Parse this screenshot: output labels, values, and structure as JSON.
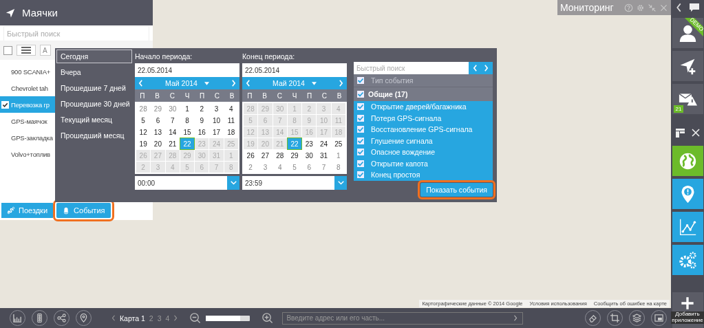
{
  "header": {
    "title": "Мониторинг"
  },
  "map": {
    "attribution": [
      "Картографические данные © 2014 Google",
      "Условия использования",
      "Сообщить об ошибке на карте"
    ]
  },
  "beacons_panel": {
    "title": "Маячки",
    "search": {
      "placeholder": "Быстрый поиск"
    },
    "select_all": {
      "checked": false
    },
    "sort_button": "A",
    "items": [
      {
        "label": "900 SCANIA+",
        "checked": false
      },
      {
        "label": "Chevrolet tah",
        "checked": false
      },
      {
        "label": "Перевозка гр",
        "checked": true
      },
      {
        "label": "GPS-маячок",
        "checked": false
      },
      {
        "label": "GPS-закладка",
        "checked": false
      },
      {
        "label": "Volvo+топлив",
        "checked": false
      }
    ],
    "buttons": [
      {
        "label": "Поездки",
        "kind": "trips",
        "highlighted": false
      },
      {
        "label": "События",
        "kind": "events",
        "highlighted": true
      }
    ]
  },
  "period_popup": {
    "presets": [
      {
        "label": "Сегодня",
        "selected": true
      },
      {
        "label": "Вчера",
        "selected": false
      },
      {
        "label": "Прошедшие 7 дней",
        "selected": false
      },
      {
        "label": "Прошедшие 30 дней",
        "selected": false
      },
      {
        "label": "Текущий месяц",
        "selected": false
      },
      {
        "label": "Прошедший месяц",
        "selected": false
      }
    ],
    "calendars": [
      {
        "label": "Начало периода:",
        "date": "22.05.2014",
        "month": "Май 2014",
        "time": "00:00",
        "weekdays": [
          "П",
          "В",
          "С",
          "Ч",
          "П",
          "С",
          "В"
        ],
        "days": [
          {
            "label": "28",
            "other_month": true,
            "disabled": false,
            "selected": false
          },
          {
            "label": "29",
            "other_month": true,
            "disabled": false,
            "selected": false
          },
          {
            "label": "30",
            "other_month": true,
            "disabled": false,
            "selected": false
          },
          {
            "label": "1",
            "other_month": false,
            "disabled": false,
            "selected": false
          },
          {
            "label": "2",
            "other_month": false,
            "disabled": false,
            "selected": false
          },
          {
            "label": "3",
            "other_month": false,
            "disabled": false,
            "selected": false
          },
          {
            "label": "4",
            "other_month": false,
            "disabled": false,
            "selected": false
          },
          {
            "label": "5",
            "other_month": false,
            "disabled": false,
            "selected": false
          },
          {
            "label": "6",
            "other_month": false,
            "disabled": false,
            "selected": false
          },
          {
            "label": "7",
            "other_month": false,
            "disabled": false,
            "selected": false
          },
          {
            "label": "8",
            "other_month": false,
            "disabled": false,
            "selected": false
          },
          {
            "label": "9",
            "other_month": false,
            "disabled": false,
            "selected": false
          },
          {
            "label": "10",
            "other_month": false,
            "disabled": false,
            "selected": false
          },
          {
            "label": "11",
            "other_month": false,
            "disabled": false,
            "selected": false
          },
          {
            "label": "12",
            "other_month": false,
            "disabled": false,
            "selected": false
          },
          {
            "label": "13",
            "other_month": false,
            "disabled": false,
            "selected": false
          },
          {
            "label": "14",
            "other_month": false,
            "disabled": false,
            "selected": false
          },
          {
            "label": "15",
            "other_month": false,
            "disabled": false,
            "selected": false
          },
          {
            "label": "16",
            "other_month": false,
            "disabled": false,
            "selected": false
          },
          {
            "label": "17",
            "other_month": false,
            "disabled": false,
            "selected": false
          },
          {
            "label": "18",
            "other_month": false,
            "disabled": false,
            "selected": false
          },
          {
            "label": "19",
            "other_month": false,
            "disabled": false,
            "selected": false
          },
          {
            "label": "20",
            "other_month": false,
            "disabled": false,
            "selected": false
          },
          {
            "label": "21",
            "other_month": false,
            "disabled": false,
            "selected": false
          },
          {
            "label": "22",
            "other_month": false,
            "disabled": false,
            "selected": true
          },
          {
            "label": "23",
            "other_month": false,
            "disabled": true,
            "selected": false
          },
          {
            "label": "24",
            "other_month": false,
            "disabled": true,
            "selected": false
          },
          {
            "label": "25",
            "other_month": false,
            "disabled": true,
            "selected": false
          },
          {
            "label": "26",
            "other_month": false,
            "disabled": true,
            "selected": false
          },
          {
            "label": "27",
            "other_month": false,
            "disabled": true,
            "selected": false
          },
          {
            "label": "28",
            "other_month": false,
            "disabled": true,
            "selected": false
          },
          {
            "label": "29",
            "other_month": false,
            "disabled": true,
            "selected": false
          },
          {
            "label": "30",
            "other_month": false,
            "disabled": true,
            "selected": false
          },
          {
            "label": "31",
            "other_month": false,
            "disabled": true,
            "selected": false
          },
          {
            "label": "1",
            "other_month": true,
            "disabled": true,
            "selected": false
          },
          {
            "label": "2",
            "other_month": true,
            "disabled": true,
            "selected": false
          },
          {
            "label": "3",
            "other_month": true,
            "disabled": true,
            "selected": false
          },
          {
            "label": "4",
            "other_month": true,
            "disabled": true,
            "selected": false
          },
          {
            "label": "5",
            "other_month": true,
            "disabled": true,
            "selected": false
          },
          {
            "label": "6",
            "other_month": true,
            "disabled": true,
            "selected": false
          },
          {
            "label": "7",
            "other_month": true,
            "disabled": true,
            "selected": false
          },
          {
            "label": "8",
            "other_month": true,
            "disabled": true,
            "selected": false
          }
        ]
      },
      {
        "label": "Конец периода:",
        "date": "22.05.2014",
        "month": "Май 2014",
        "time": "23:59",
        "weekdays": [
          "П",
          "В",
          "С",
          "Ч",
          "П",
          "С",
          "В"
        ],
        "days": [
          {
            "label": "28",
            "other_month": true,
            "disabled": true,
            "selected": false
          },
          {
            "label": "29",
            "other_month": true,
            "disabled": true,
            "selected": false
          },
          {
            "label": "30",
            "other_month": true,
            "disabled": true,
            "selected": false
          },
          {
            "label": "1",
            "other_month": false,
            "disabled": true,
            "selected": false
          },
          {
            "label": "2",
            "other_month": false,
            "disabled": true,
            "selected": false
          },
          {
            "label": "3",
            "other_month": false,
            "disabled": true,
            "selected": false
          },
          {
            "label": "4",
            "other_month": false,
            "disabled": true,
            "selected": false
          },
          {
            "label": "5",
            "other_month": false,
            "disabled": true,
            "selected": false
          },
          {
            "label": "6",
            "other_month": false,
            "disabled": true,
            "selected": false
          },
          {
            "label": "7",
            "other_month": false,
            "disabled": true,
            "selected": false
          },
          {
            "label": "8",
            "other_month": false,
            "disabled": true,
            "selected": false
          },
          {
            "label": "9",
            "other_month": false,
            "disabled": true,
            "selected": false
          },
          {
            "label": "10",
            "other_month": false,
            "disabled": true,
            "selected": false
          },
          {
            "label": "11",
            "other_month": false,
            "disabled": true,
            "selected": false
          },
          {
            "label": "12",
            "other_month": false,
            "disabled": true,
            "selected": false
          },
          {
            "label": "13",
            "other_month": false,
            "disabled": true,
            "selected": false
          },
          {
            "label": "14",
            "other_month": false,
            "disabled": true,
            "selected": false
          },
          {
            "label": "15",
            "other_month": false,
            "disabled": true,
            "selected": false
          },
          {
            "label": "16",
            "other_month": false,
            "disabled": true,
            "selected": false
          },
          {
            "label": "17",
            "other_month": false,
            "disabled": true,
            "selected": false
          },
          {
            "label": "18",
            "other_month": false,
            "disabled": true,
            "selected": false
          },
          {
            "label": "19",
            "other_month": false,
            "disabled": true,
            "selected": false
          },
          {
            "label": "20",
            "other_month": false,
            "disabled": true,
            "selected": false
          },
          {
            "label": "21",
            "other_month": false,
            "disabled": true,
            "selected": false
          },
          {
            "label": "22",
            "other_month": false,
            "disabled": false,
            "selected": true
          },
          {
            "label": "23",
            "other_month": false,
            "disabled": false,
            "selected": false
          },
          {
            "label": "24",
            "other_month": false,
            "disabled": false,
            "selected": false
          },
          {
            "label": "25",
            "other_month": false,
            "disabled": false,
            "selected": false
          },
          {
            "label": "26",
            "other_month": false,
            "disabled": false,
            "selected": false
          },
          {
            "label": "27",
            "other_month": false,
            "disabled": false,
            "selected": false
          },
          {
            "label": "28",
            "other_month": false,
            "disabled": false,
            "selected": false
          },
          {
            "label": "29",
            "other_month": false,
            "disabled": false,
            "selected": false
          },
          {
            "label": "30",
            "other_month": false,
            "disabled": false,
            "selected": false
          },
          {
            "label": "31",
            "other_month": false,
            "disabled": false,
            "selected": false
          },
          {
            "label": "1",
            "other_month": true,
            "disabled": false,
            "selected": false
          },
          {
            "label": "2",
            "other_month": true,
            "disabled": false,
            "selected": false
          },
          {
            "label": "3",
            "other_month": true,
            "disabled": false,
            "selected": false
          },
          {
            "label": "4",
            "other_month": true,
            "disabled": false,
            "selected": false
          },
          {
            "label": "5",
            "other_month": true,
            "disabled": false,
            "selected": false
          },
          {
            "label": "6",
            "other_month": true,
            "disabled": false,
            "selected": false
          },
          {
            "label": "7",
            "other_month": true,
            "disabled": false,
            "selected": false
          },
          {
            "label": "8",
            "other_month": true,
            "disabled": false,
            "selected": false
          }
        ]
      }
    ],
    "events": {
      "search": {
        "placeholder": "Быстрый поиск"
      },
      "header": {
        "label": "Тип события",
        "checked": true
      },
      "group": {
        "label": "Общие (17)",
        "checked": true
      },
      "items": [
        {
          "label": "Открытие дверей/багажника",
          "checked": true
        },
        {
          "label": "Потеря GPS-сигнала",
          "checked": true
        },
        {
          "label": "Восстановление GPS-сигнала",
          "checked": true
        },
        {
          "label": "Глушение сигнала",
          "checked": true
        },
        {
          "label": "Опасное вождение",
          "checked": true
        },
        {
          "label": "Открытие капота",
          "checked": true
        },
        {
          "label": "Конец простоя",
          "checked": true
        }
      ],
      "show_button": {
        "label": "Показать события",
        "highlighted": true
      }
    }
  },
  "sidebar": {
    "tiles": [
      {
        "kind": "user",
        "badge": "DEMO"
      },
      {
        "kind": "navigate"
      },
      {
        "kind": "mail-alert",
        "count": "21"
      },
      {
        "kind": "layout"
      },
      {
        "kind": "globe",
        "color": "#6cbb2a"
      },
      {
        "kind": "pin",
        "color": "#27a6e0"
      },
      {
        "kind": "chart",
        "color": "#27a6e0"
      },
      {
        "kind": "gears",
        "color": "#27a6e0"
      },
      {
        "kind": "add",
        "label": "Добавить приложение"
      }
    ]
  },
  "bottom_bar": {
    "tools": [
      {
        "kind": "chart"
      },
      {
        "kind": "traffic"
      },
      {
        "kind": "share"
      },
      {
        "kind": "pin"
      }
    ],
    "maps": [
      {
        "label": "Карта 1",
        "selected": true
      },
      {
        "label": "2",
        "selected": false
      },
      {
        "label": "3",
        "selected": false
      },
      {
        "label": "4",
        "selected": false
      }
    ],
    "zoom": {
      "level": 0.78
    },
    "address": {
      "placeholder": "Введите адрес или его часть..."
    },
    "right_tools": [
      {
        "kind": "eraser"
      },
      {
        "kind": "crop"
      },
      {
        "kind": "layers"
      },
      {
        "kind": "window"
      }
    ]
  }
}
